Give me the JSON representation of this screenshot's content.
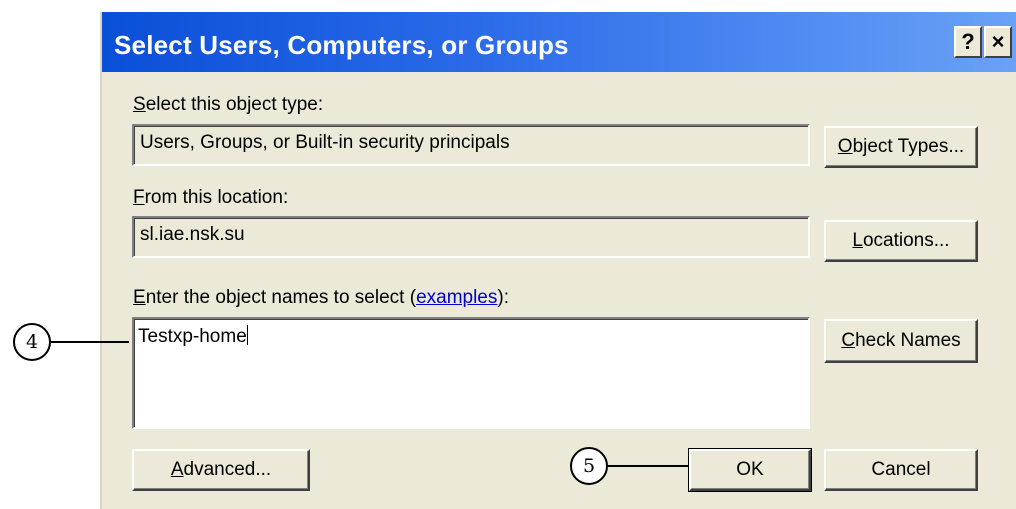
{
  "dialog": {
    "title": "Select Users, Computers, or Groups",
    "help_label": "?",
    "close_label": "×",
    "object_type": {
      "label_mnemonic": "S",
      "label_rest": "elect this object type:",
      "value": "Users, Groups, or Built-in security principals",
      "button_mnemonic": "O",
      "button_rest": "bject Types..."
    },
    "location": {
      "label_mnemonic": "F",
      "label_rest": "rom this location:",
      "value": "sl.iae.nsk.su",
      "button_mnemonic": "L",
      "button_rest": "ocations..."
    },
    "names": {
      "label_mnemonic": "E",
      "label_prefix": "nter the object names to select (",
      "link": "examples",
      "label_suffix": "):",
      "value": "Testxp-home",
      "button_mnemonic": "C",
      "button_rest": "heck Names"
    },
    "advanced_mnemonic": "A",
    "advanced_rest": "dvanced...",
    "ok_label": "OK",
    "cancel_label": "Cancel"
  },
  "callouts": {
    "step4": "4",
    "step5": "5"
  }
}
